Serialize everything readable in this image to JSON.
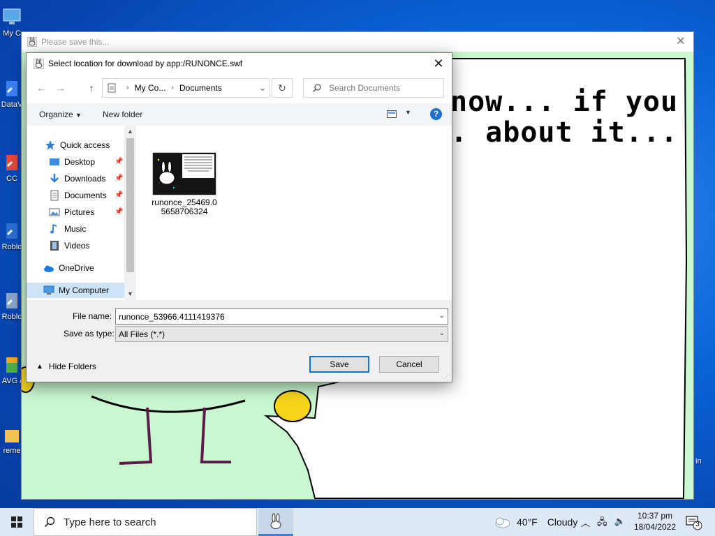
{
  "desktop": {
    "icons": [
      {
        "name": "my-computer-desktop-icon",
        "label": "My C"
      },
      {
        "name": "datav-desktop-icon",
        "label": "DataV"
      },
      {
        "name": "cc-desktop-icon",
        "label": "CC"
      },
      {
        "name": "roblox-desktop-icon",
        "label": "Roblo"
      },
      {
        "name": "roblox-studio-desktop-icon",
        "label": "Roblo"
      },
      {
        "name": "avg-desktop-icon",
        "label": "AVG /"
      },
      {
        "name": "reme-desktop-icon",
        "label": "reme"
      }
    ],
    "right_partial_label": "in"
  },
  "flash_window": {
    "title": "Please save this...",
    "speech_text": "now... if you\n. about it..."
  },
  "dialog": {
    "title": "Select location for download by app:/RUNONCE.swf",
    "address": {
      "segment1": "My Co...",
      "segment2": "Documents"
    },
    "search_placeholder": "Search Documents",
    "toolbar": {
      "organize": "Organize",
      "new_folder": "New folder",
      "help": "?"
    },
    "nav_items": {
      "quick_access": "Quick access",
      "desktop": "Desktop",
      "downloads": "Downloads",
      "documents": "Documents",
      "pictures": "Pictures",
      "music": "Music",
      "videos": "Videos",
      "onedrive": "OneDrive",
      "my_computer": "My Computer"
    },
    "file": {
      "name": "runonce_25469.05658706324"
    },
    "file_name_label": "File name:",
    "file_name_value": "runonce_53966.4111419376",
    "save_type_label": "Save as type:",
    "save_type_value": "All Files (*.*)",
    "hide_folders": "Hide Folders",
    "save_button": "Save",
    "cancel_button": "Cancel"
  },
  "taskbar": {
    "search_placeholder": "Type here to search",
    "weather_temp": "40°F",
    "weather_cond": "Cloudy",
    "time": "10:37 pm",
    "date": "18/04/2022",
    "notifications_count": "3"
  },
  "colors": {
    "desktop_bg": "#0a63d6",
    "flash_bg": "#c9f7cf",
    "accent": "#0078d7",
    "selected_nav": "#cce4f7"
  }
}
